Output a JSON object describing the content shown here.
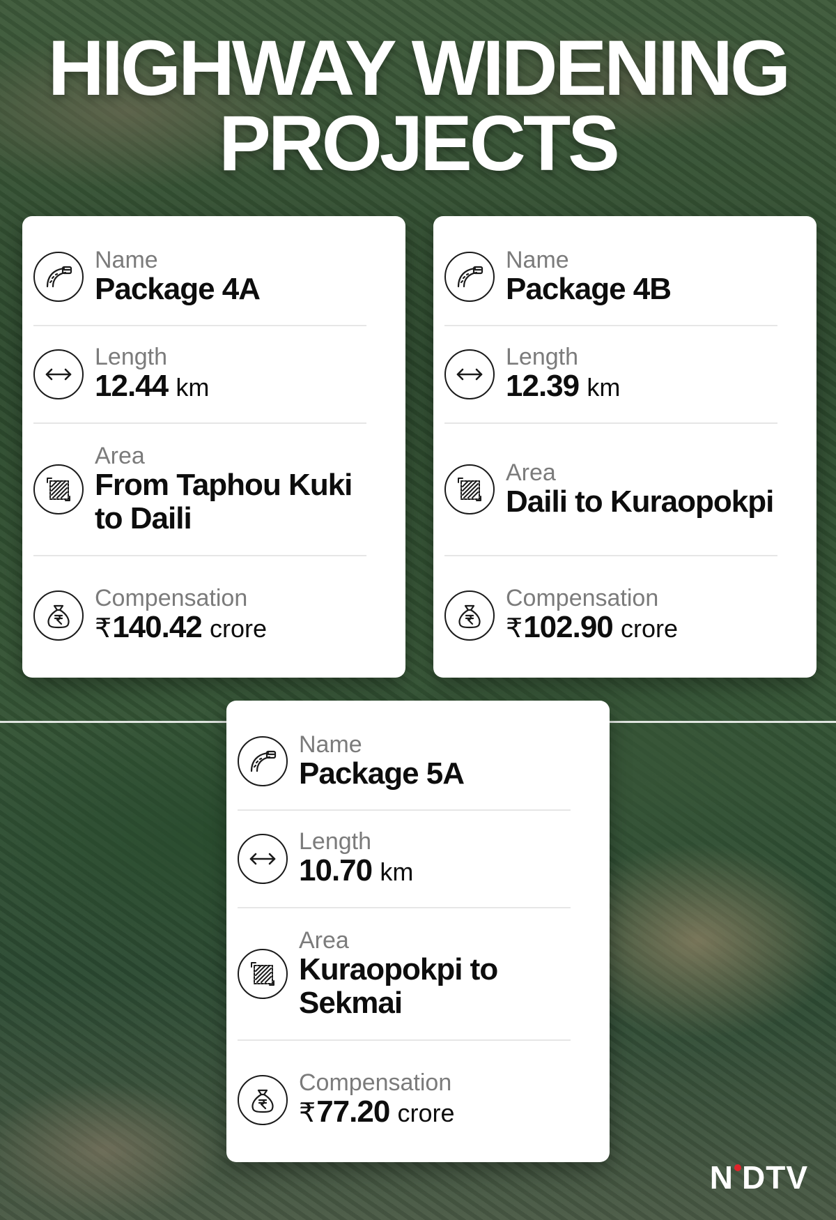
{
  "title": {
    "line1": "HIGHWAY WIDENING",
    "line2": "PROJECTS"
  },
  "labels": {
    "name": "Name",
    "length": "Length",
    "area": "Area",
    "compensation": "Compensation"
  },
  "units": {
    "length": "km",
    "currency": "₹",
    "money": "crore"
  },
  "icons": {
    "name": "road-icon",
    "length": "double-arrow-icon",
    "area": "area-icon",
    "compensation": "money-bag-rupee-icon"
  },
  "packages": [
    {
      "name": "Package 4A",
      "length": "12.44",
      "area": "From Taphou Kuki to Daili",
      "compensation": "140.42"
    },
    {
      "name": "Package 4B",
      "length": "12.39",
      "area": "Daili to Kuraopokpi",
      "compensation": "102.90"
    },
    {
      "name": "Package 5A",
      "length": "10.70",
      "area": "Kuraopokpi to Sekmai",
      "compensation": "77.20"
    }
  ],
  "logo": {
    "left": "N",
    "right": "DTV"
  },
  "colors": {
    "accent": "#e0242b",
    "card": "#ffffff",
    "label": "#7b7b7b"
  }
}
